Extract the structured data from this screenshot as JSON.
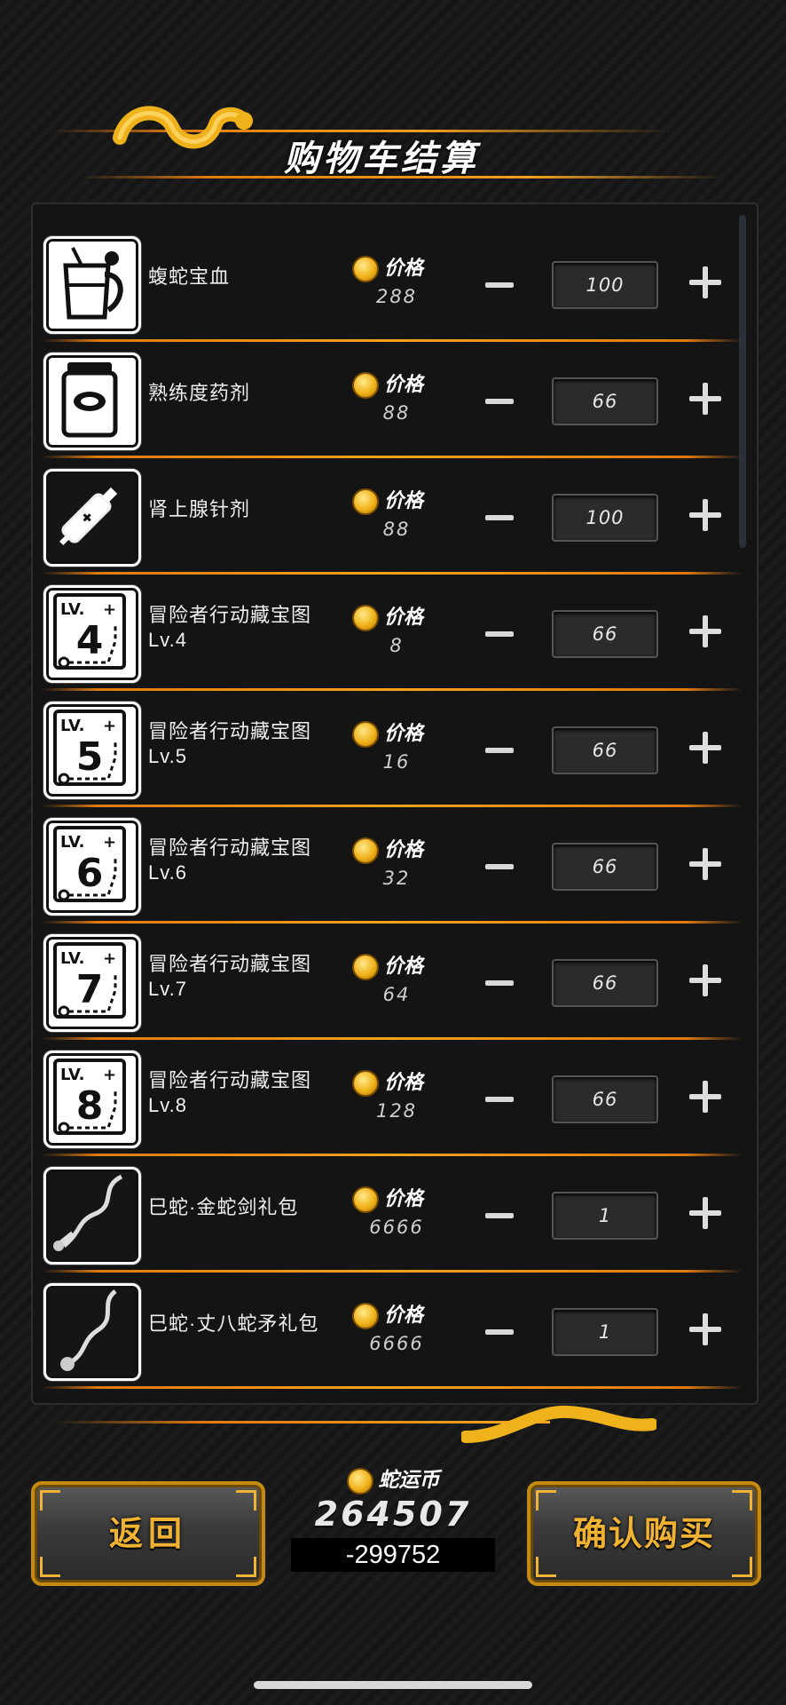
{
  "header": {
    "title": "购物车结算"
  },
  "cart": {
    "price_label": "价格",
    "items": [
      {
        "name": "蝮蛇宝血",
        "name2": "",
        "price": "288",
        "qty": "100",
        "icon": "snake-blood-cup-icon"
      },
      {
        "name": "熟练度药剂",
        "name2": "",
        "price": "88",
        "qty": "66",
        "icon": "potion-jar-icon"
      },
      {
        "name": "肾上腺针剂",
        "name2": "",
        "price": "88",
        "qty": "100",
        "icon": "syringe-icon"
      },
      {
        "name": "冒险者行动藏宝图",
        "name2": "Lv.4",
        "price": "8",
        "qty": "66",
        "icon": "treasure-map-icon",
        "level": "4"
      },
      {
        "name": "冒险者行动藏宝图",
        "name2": "Lv.5",
        "price": "16",
        "qty": "66",
        "icon": "treasure-map-icon",
        "level": "5"
      },
      {
        "name": "冒险者行动藏宝图",
        "name2": "Lv.6",
        "price": "32",
        "qty": "66",
        "icon": "treasure-map-icon",
        "level": "6"
      },
      {
        "name": "冒险者行动藏宝图",
        "name2": "Lv.7",
        "price": "64",
        "qty": "66",
        "icon": "treasure-map-icon",
        "level": "7"
      },
      {
        "name": "冒险者行动藏宝图",
        "name2": "Lv.8",
        "price": "128",
        "qty": "66",
        "icon": "treasure-map-icon",
        "level": "8"
      },
      {
        "name": "巳蛇·金蛇剑礼包",
        "name2": "",
        "price": "6666",
        "qty": "1",
        "icon": "snake-sword-icon"
      },
      {
        "name": "巳蛇·丈八蛇矛礼包",
        "name2": "",
        "price": "6666",
        "qty": "1",
        "icon": "snake-spear-icon"
      }
    ],
    "map_badge": "LV."
  },
  "footer": {
    "back_label": "返回",
    "confirm_label": "确认购买",
    "currency_label": "蛇运币",
    "currency_amount": "264507",
    "currency_delta": "-299752"
  },
  "colors": {
    "accent": "#f0a020",
    "gold": "#f0b232",
    "panel": "#141414"
  }
}
